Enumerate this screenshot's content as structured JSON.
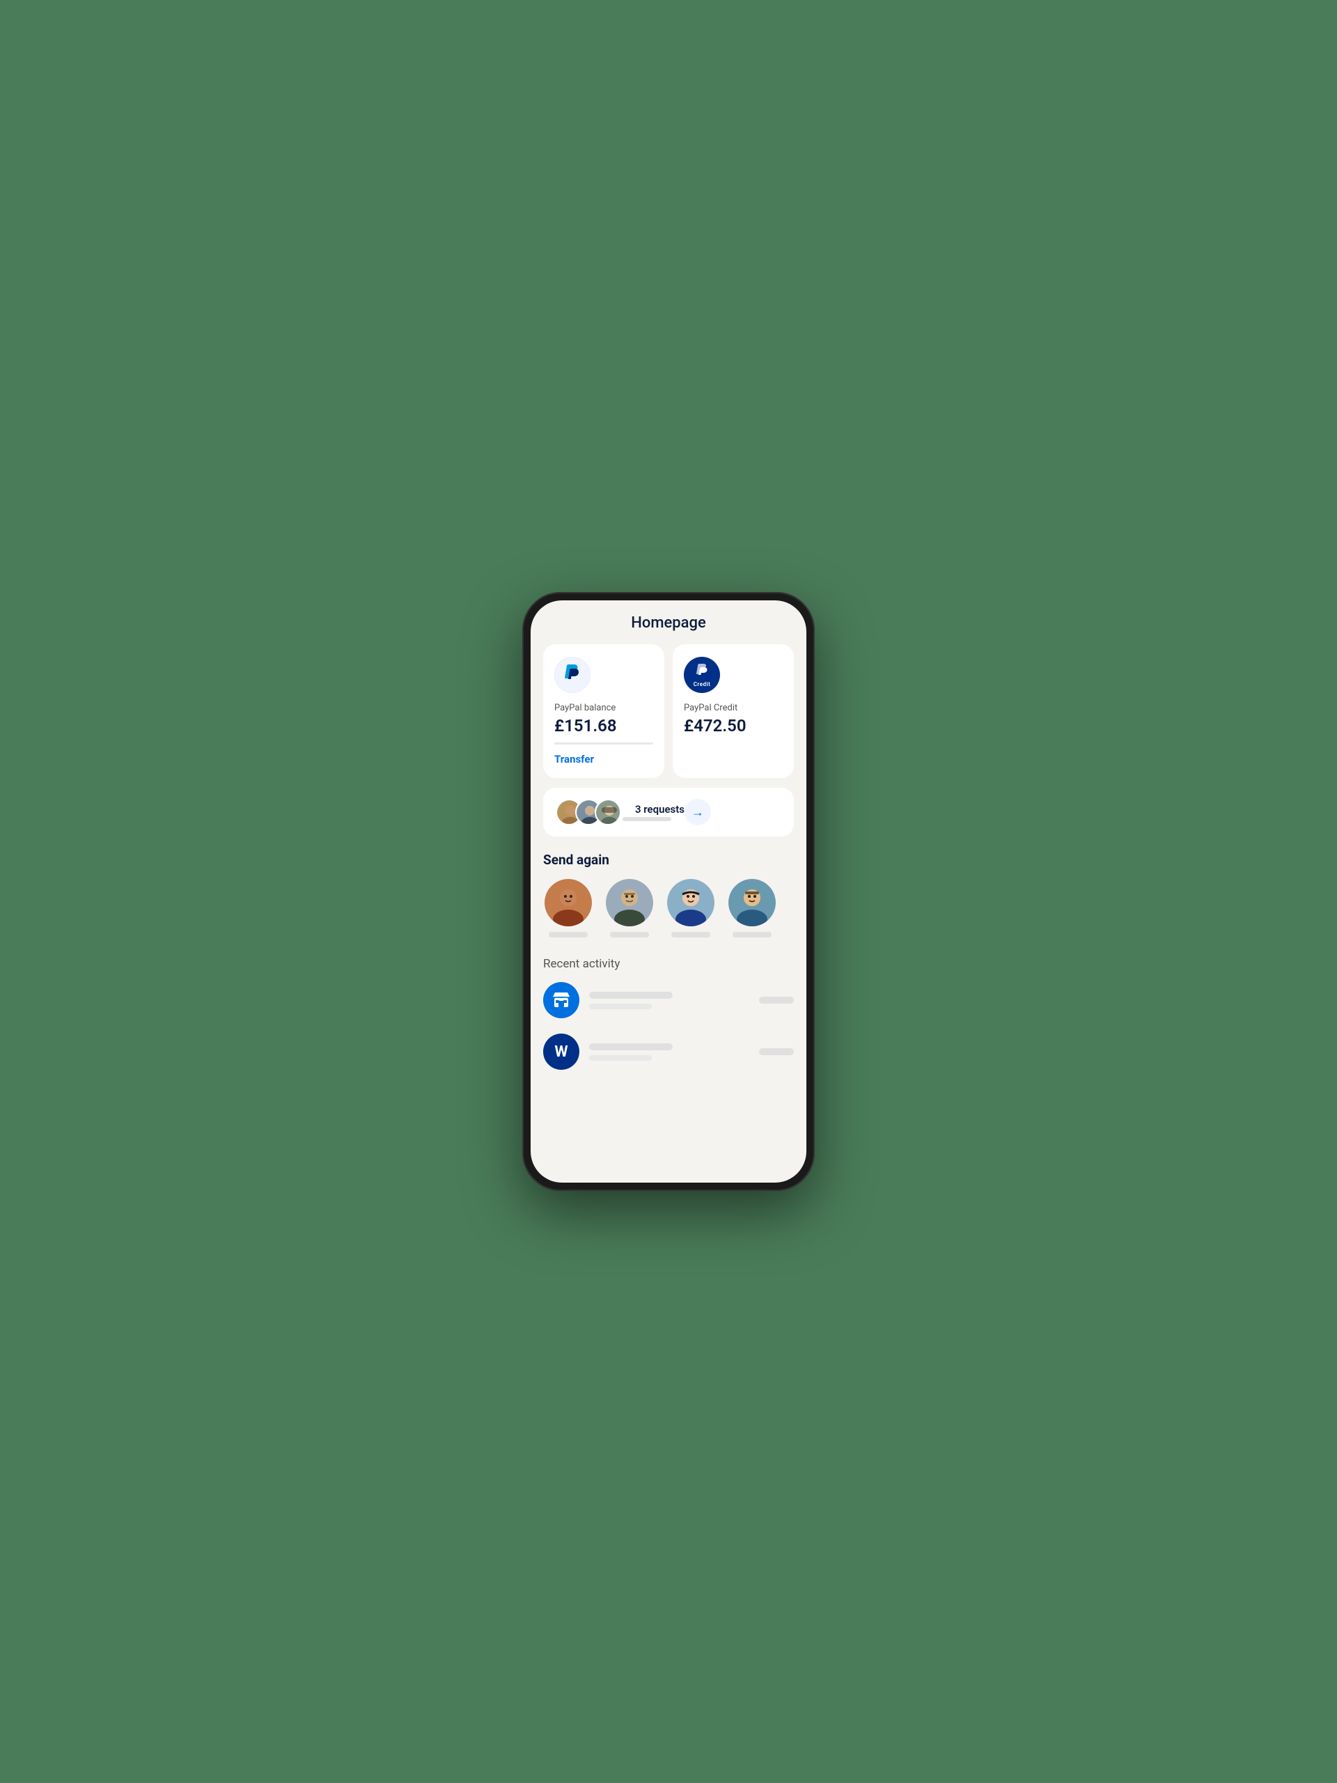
{
  "page": {
    "title": "Homepage",
    "background_color": "#f5f3ef"
  },
  "balance_cards": [
    {
      "id": "paypal-balance",
      "logo_type": "white",
      "label": "PayPal balance",
      "amount": "£151.68",
      "action_label": "Transfer"
    },
    {
      "id": "paypal-credit",
      "logo_type": "blue",
      "label": "PayPal Credit",
      "amount": "£472.50",
      "credit_text": "Credit"
    }
  ],
  "requests": {
    "count": 3,
    "label": "3 requests"
  },
  "send_again": {
    "title": "Send again",
    "contacts": [
      {
        "id": 1,
        "face_class": "face-1"
      },
      {
        "id": 2,
        "face_class": "face-2"
      },
      {
        "id": 3,
        "face_class": "face-3"
      },
      {
        "id": 4,
        "face_class": "face-4"
      },
      {
        "id": 5,
        "face_class": "face-5"
      }
    ]
  },
  "recent_activity": {
    "title": "Recent activity",
    "items": [
      {
        "id": 1,
        "icon_type": "store",
        "icon_bg": "blue-store"
      },
      {
        "id": 2,
        "icon_type": "letter",
        "icon_bg": "dark-blue",
        "letter": "W"
      }
    ]
  }
}
